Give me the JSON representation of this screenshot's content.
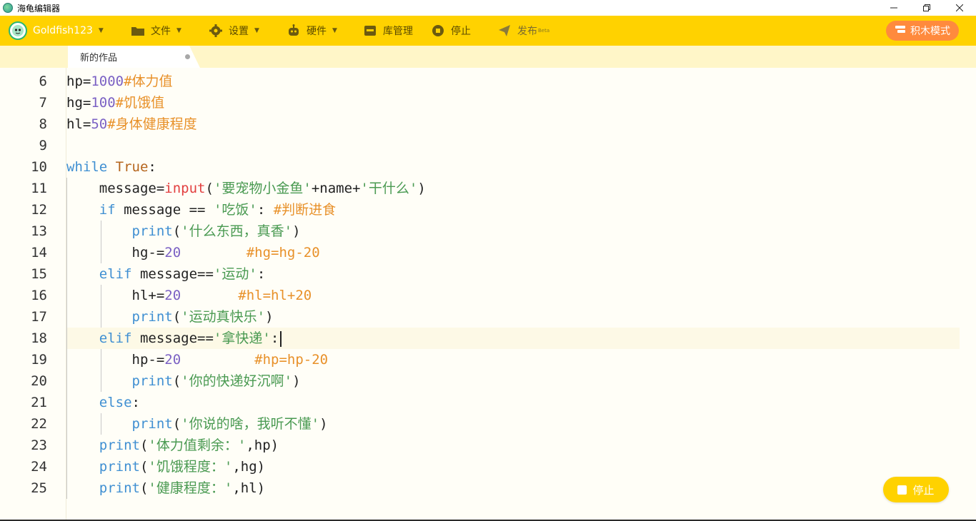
{
  "window": {
    "title": "海龟编辑器",
    "controls": [
      "minimize-icon",
      "restore-icon",
      "close-icon"
    ]
  },
  "toolbar": {
    "user": "Goldfish123",
    "items": [
      {
        "label": "文件",
        "icon": "folder-icon",
        "has_caret": true
      },
      {
        "label": "设置",
        "icon": "gear-icon",
        "has_caret": true
      },
      {
        "label": "硬件",
        "icon": "robot-icon",
        "has_caret": true
      },
      {
        "label": "库管理",
        "icon": "library-icon",
        "has_caret": false
      },
      {
        "label": "停止",
        "icon": "stop-icon",
        "has_caret": false
      },
      {
        "label": "发布",
        "icon": "send-icon",
        "has_caret": false,
        "badge": "Beta"
      }
    ],
    "block_mode_label": "积木模式"
  },
  "tabs": [
    {
      "title": "新的作品",
      "unsaved": true
    }
  ],
  "editor": {
    "active_line": 18,
    "lines": [
      {
        "num": "6",
        "indent": 0,
        "tokens": [
          [
            "plain",
            "hp="
          ],
          [
            "num",
            "1000"
          ],
          [
            "cm",
            "#体力值"
          ]
        ]
      },
      {
        "num": "7",
        "indent": 0,
        "tokens": [
          [
            "plain",
            "hg="
          ],
          [
            "num",
            "100"
          ],
          [
            "cm",
            "#饥饿值"
          ]
        ]
      },
      {
        "num": "8",
        "indent": 0,
        "tokens": [
          [
            "plain",
            "hl="
          ],
          [
            "num",
            "50"
          ],
          [
            "cm",
            "#身体健康程度"
          ]
        ]
      },
      {
        "num": "9",
        "indent": 0,
        "tokens": []
      },
      {
        "num": "10",
        "indent": 0,
        "tokens": [
          [
            "kw",
            "while"
          ],
          [
            "plain",
            " "
          ],
          [
            "const",
            "True"
          ],
          [
            "plain",
            ":"
          ]
        ]
      },
      {
        "num": "11",
        "indent": 1,
        "tokens": [
          [
            "plain",
            "message="
          ],
          [
            "input",
            "input"
          ],
          [
            "plain",
            "("
          ],
          [
            "str",
            "'要宠物小金鱼'"
          ],
          [
            "plain",
            "+name+"
          ],
          [
            "str",
            "'干什么'"
          ],
          [
            "plain",
            ")"
          ]
        ]
      },
      {
        "num": "12",
        "indent": 1,
        "tokens": [
          [
            "kw",
            "if"
          ],
          [
            "plain",
            " message == "
          ],
          [
            "str",
            "'吃饭'"
          ],
          [
            "plain",
            ": "
          ],
          [
            "cm",
            "#判断进食"
          ]
        ]
      },
      {
        "num": "13",
        "indent": 2,
        "tokens": [
          [
            "fn",
            "print"
          ],
          [
            "plain",
            "("
          ],
          [
            "str",
            "'什么东西，真香'"
          ],
          [
            "plain",
            ")"
          ]
        ]
      },
      {
        "num": "14",
        "indent": 2,
        "tokens": [
          [
            "plain",
            "hg-="
          ],
          [
            "num",
            "20"
          ],
          [
            "plain",
            "        "
          ],
          [
            "cm",
            "#hg=hg-20"
          ]
        ]
      },
      {
        "num": "15",
        "indent": 1,
        "tokens": [
          [
            "kw",
            "elif"
          ],
          [
            "plain",
            " message=="
          ],
          [
            "str",
            "'运动'"
          ],
          [
            "plain",
            ":"
          ]
        ]
      },
      {
        "num": "16",
        "indent": 2,
        "tokens": [
          [
            "plain",
            "hl+="
          ],
          [
            "num",
            "20"
          ],
          [
            "plain",
            "       "
          ],
          [
            "cm",
            "#hl=hl+20"
          ]
        ]
      },
      {
        "num": "17",
        "indent": 2,
        "tokens": [
          [
            "fn",
            "print"
          ],
          [
            "plain",
            "("
          ],
          [
            "str",
            "'运动真快乐'"
          ],
          [
            "plain",
            ")"
          ]
        ]
      },
      {
        "num": "18",
        "indent": 1,
        "tokens": [
          [
            "kw",
            "elif"
          ],
          [
            "plain",
            " message=="
          ],
          [
            "str",
            "'拿快递'"
          ],
          [
            "plain",
            ":"
          ]
        ]
      },
      {
        "num": "19",
        "indent": 2,
        "tokens": [
          [
            "plain",
            "hp-="
          ],
          [
            "num",
            "20"
          ],
          [
            "plain",
            "         "
          ],
          [
            "cm",
            "#hp=hp-20"
          ]
        ]
      },
      {
        "num": "20",
        "indent": 2,
        "tokens": [
          [
            "fn",
            "print"
          ],
          [
            "plain",
            "("
          ],
          [
            "str",
            "'你的快递好沉啊'"
          ],
          [
            "plain",
            ")"
          ]
        ]
      },
      {
        "num": "21",
        "indent": 1,
        "tokens": [
          [
            "kw",
            "else"
          ],
          [
            "plain",
            ":"
          ]
        ]
      },
      {
        "num": "22",
        "indent": 2,
        "tokens": [
          [
            "fn",
            "print"
          ],
          [
            "plain",
            "("
          ],
          [
            "str",
            "'你说的啥，我听不懂'"
          ],
          [
            "plain",
            ")"
          ]
        ]
      },
      {
        "num": "23",
        "indent": 1,
        "tokens": [
          [
            "fn",
            "print"
          ],
          [
            "plain",
            "("
          ],
          [
            "str",
            "'体力值剩余：'"
          ],
          [
            "plain",
            ",hp)"
          ]
        ]
      },
      {
        "num": "24",
        "indent": 1,
        "tokens": [
          [
            "fn",
            "print"
          ],
          [
            "plain",
            "("
          ],
          [
            "str",
            "'饥饿程度：'"
          ],
          [
            "plain",
            ",hg)"
          ]
        ]
      },
      {
        "num": "25",
        "indent": 1,
        "tokens": [
          [
            "fn",
            "print"
          ],
          [
            "plain",
            "("
          ],
          [
            "str",
            "'健康程度：'"
          ],
          [
            "plain",
            ",hl)"
          ]
        ]
      }
    ]
  },
  "floating_stop": {
    "label": "停止"
  },
  "colors": {
    "toolbar": "#ffd200",
    "block_mode": "#ff8a3d",
    "keyword": "#3f8fd2",
    "string": "#4a9a52",
    "number": "#7b61c4",
    "comment": "#e8912a",
    "input_builtin": "#e24040",
    "constant": "#b5651d"
  }
}
